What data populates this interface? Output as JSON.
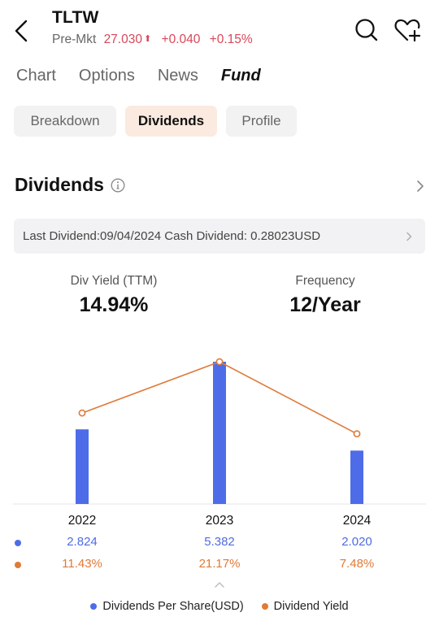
{
  "header": {
    "ticker": "TLTW",
    "premarket_label": "Pre-Mkt",
    "price": "27.030",
    "change": "+0.040",
    "change_pct": "+0.15%",
    "direction": "up",
    "up_color": "#d9475a"
  },
  "icons": {
    "back": "chevron-left-icon",
    "search": "search-icon",
    "watchlist": "heart-plus-icon",
    "info": "info-icon",
    "chevron": "chevron-right-icon",
    "collapse": "chevron-up-icon"
  },
  "tabs": [
    {
      "label": "Chart",
      "active": false
    },
    {
      "label": "Options",
      "active": false
    },
    {
      "label": "News",
      "active": false
    },
    {
      "label": "Fund",
      "active": true
    }
  ],
  "subtabs": [
    {
      "label": "Breakdown",
      "active": false
    },
    {
      "label": "Dividends",
      "active": true
    },
    {
      "label": "Profile",
      "active": false
    }
  ],
  "section": {
    "title": "Dividends"
  },
  "last_dividend": {
    "text": "Last Dividend:09/04/2024 Cash Dividend: 0.28023USD"
  },
  "stats": {
    "yield_label": "Div Yield (TTM)",
    "yield_value": "14.94%",
    "frequency_label": "Frequency",
    "frequency_value": "12/Year"
  },
  "colors": {
    "bar": "#4e6ce8",
    "line": "#e07a38",
    "accent": "#e56a1f",
    "active_subtab_bg": "#fbeadf"
  },
  "chart_data": {
    "type": "bar",
    "categories": [
      "2022",
      "2023",
      "2024"
    ],
    "series": [
      {
        "name": "Dividends Per Share(USD)",
        "type": "bar",
        "values": [
          2.824,
          5.382,
          2.02
        ],
        "labels": [
          "2.824",
          "5.382",
          "2.020"
        ],
        "color": "#4e6ce8"
      },
      {
        "name": "Dividend Yield",
        "type": "line",
        "values": [
          11.43,
          21.17,
          7.48
        ],
        "labels": [
          "11.43%",
          "21.17%",
          "7.48%"
        ],
        "color": "#e07a38"
      }
    ],
    "title": "",
    "xlabel": "",
    "ylabel": "",
    "ylim_bar": [
      0,
      5.382
    ],
    "ylim_line": [
      -5.7,
      21.17
    ],
    "grid": false,
    "legend": "bottom-center"
  }
}
